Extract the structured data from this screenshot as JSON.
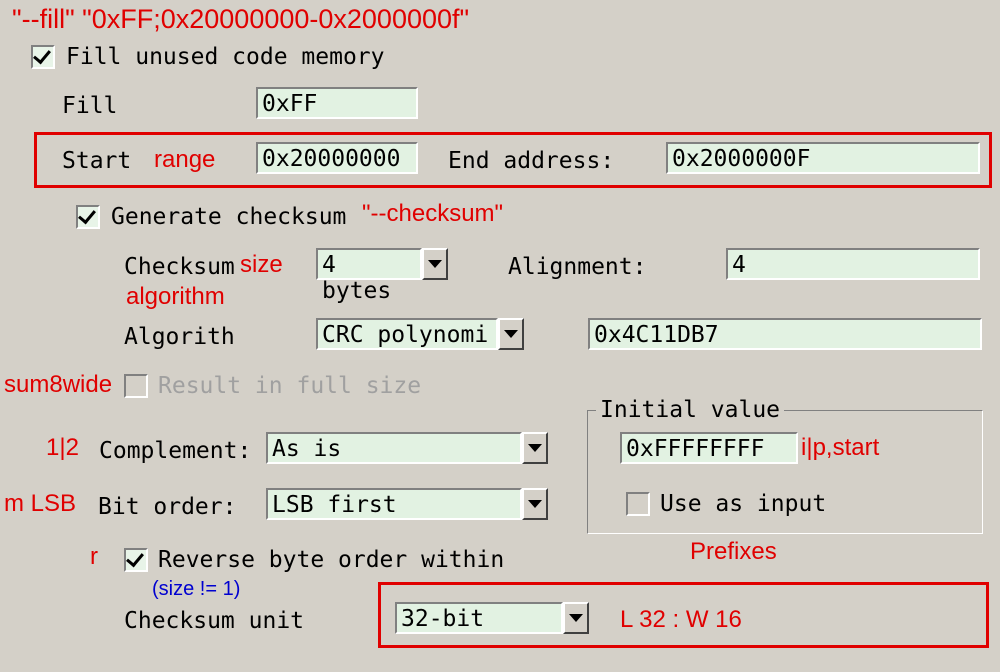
{
  "annotations": {
    "fill_cmd": "\"--fill\" \"0xFF;0x20000000-0x2000000f\"",
    "range": "range",
    "checksum_cmd": "\"--checksum\"",
    "size": "size",
    "algorithm": "algorithm",
    "sum8wide": "sum8wide",
    "one_two": "1|2",
    "m_lsb": "m  LSB",
    "r": "r",
    "ip_start": "i|p,start",
    "prefixes": "Prefixes",
    "size_ne1": "(size != 1)",
    "l32w16": "L 32 : W  16"
  },
  "fill": {
    "enable_label": "Fill unused code memory",
    "fill_label": "Fill",
    "fill_value": "0xFF",
    "start_label": "Start",
    "start_value": "0x20000000",
    "end_label": "End address:",
    "end_value": "0x2000000F"
  },
  "checksum": {
    "enable_label": "Generate checksum",
    "size_label": "Checksum",
    "size_value": "4 bytes",
    "align_label": "Alignment:",
    "align_value": "4",
    "algo_label": "Algorith",
    "algo_value": "CRC polynomi",
    "poly_value": "0x4C11DB7",
    "fullsize_label": "Result in full size",
    "complement_label": "Complement:",
    "complement_value": "As is",
    "bitorder_label": "Bit order:",
    "bitorder_value": "LSB first",
    "initial_title": "Initial value",
    "initial_value": "0xFFFFFFFF",
    "use_input_label": "Use as input",
    "reverse_label": "Reverse byte order within",
    "unit_label": "Checksum unit",
    "unit_value": "32-bit"
  }
}
